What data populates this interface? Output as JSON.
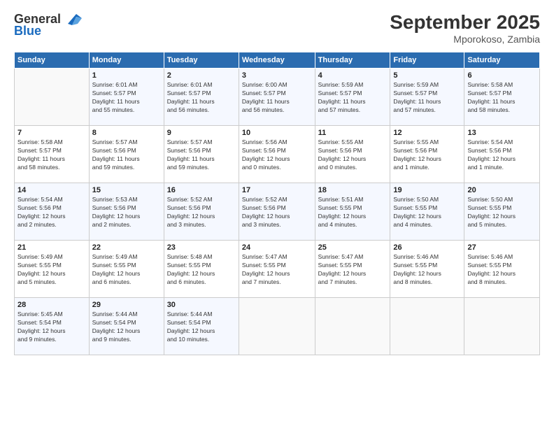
{
  "logo": {
    "text_general": "General",
    "text_blue": "Blue"
  },
  "header": {
    "month": "September 2025",
    "location": "Mporokoso, Zambia"
  },
  "weekdays": [
    "Sunday",
    "Monday",
    "Tuesday",
    "Wednesday",
    "Thursday",
    "Friday",
    "Saturday"
  ],
  "weeks": [
    [
      {
        "day": "",
        "info": ""
      },
      {
        "day": "1",
        "info": "Sunrise: 6:01 AM\nSunset: 5:57 PM\nDaylight: 11 hours\nand 55 minutes."
      },
      {
        "day": "2",
        "info": "Sunrise: 6:01 AM\nSunset: 5:57 PM\nDaylight: 11 hours\nand 56 minutes."
      },
      {
        "day": "3",
        "info": "Sunrise: 6:00 AM\nSunset: 5:57 PM\nDaylight: 11 hours\nand 56 minutes."
      },
      {
        "day": "4",
        "info": "Sunrise: 5:59 AM\nSunset: 5:57 PM\nDaylight: 11 hours\nand 57 minutes."
      },
      {
        "day": "5",
        "info": "Sunrise: 5:59 AM\nSunset: 5:57 PM\nDaylight: 11 hours\nand 57 minutes."
      },
      {
        "day": "6",
        "info": "Sunrise: 5:58 AM\nSunset: 5:57 PM\nDaylight: 11 hours\nand 58 minutes."
      }
    ],
    [
      {
        "day": "7",
        "info": "Sunrise: 5:58 AM\nSunset: 5:57 PM\nDaylight: 11 hours\nand 58 minutes."
      },
      {
        "day": "8",
        "info": "Sunrise: 5:57 AM\nSunset: 5:56 PM\nDaylight: 11 hours\nand 59 minutes."
      },
      {
        "day": "9",
        "info": "Sunrise: 5:57 AM\nSunset: 5:56 PM\nDaylight: 11 hours\nand 59 minutes."
      },
      {
        "day": "10",
        "info": "Sunrise: 5:56 AM\nSunset: 5:56 PM\nDaylight: 12 hours\nand 0 minutes."
      },
      {
        "day": "11",
        "info": "Sunrise: 5:55 AM\nSunset: 5:56 PM\nDaylight: 12 hours\nand 0 minutes."
      },
      {
        "day": "12",
        "info": "Sunrise: 5:55 AM\nSunset: 5:56 PM\nDaylight: 12 hours\nand 1 minute."
      },
      {
        "day": "13",
        "info": "Sunrise: 5:54 AM\nSunset: 5:56 PM\nDaylight: 12 hours\nand 1 minute."
      }
    ],
    [
      {
        "day": "14",
        "info": "Sunrise: 5:54 AM\nSunset: 5:56 PM\nDaylight: 12 hours\nand 2 minutes."
      },
      {
        "day": "15",
        "info": "Sunrise: 5:53 AM\nSunset: 5:56 PM\nDaylight: 12 hours\nand 2 minutes."
      },
      {
        "day": "16",
        "info": "Sunrise: 5:52 AM\nSunset: 5:56 PM\nDaylight: 12 hours\nand 3 minutes."
      },
      {
        "day": "17",
        "info": "Sunrise: 5:52 AM\nSunset: 5:56 PM\nDaylight: 12 hours\nand 3 minutes."
      },
      {
        "day": "18",
        "info": "Sunrise: 5:51 AM\nSunset: 5:55 PM\nDaylight: 12 hours\nand 4 minutes."
      },
      {
        "day": "19",
        "info": "Sunrise: 5:50 AM\nSunset: 5:55 PM\nDaylight: 12 hours\nand 4 minutes."
      },
      {
        "day": "20",
        "info": "Sunrise: 5:50 AM\nSunset: 5:55 PM\nDaylight: 12 hours\nand 5 minutes."
      }
    ],
    [
      {
        "day": "21",
        "info": "Sunrise: 5:49 AM\nSunset: 5:55 PM\nDaylight: 12 hours\nand 5 minutes."
      },
      {
        "day": "22",
        "info": "Sunrise: 5:49 AM\nSunset: 5:55 PM\nDaylight: 12 hours\nand 6 minutes."
      },
      {
        "day": "23",
        "info": "Sunrise: 5:48 AM\nSunset: 5:55 PM\nDaylight: 12 hours\nand 6 minutes."
      },
      {
        "day": "24",
        "info": "Sunrise: 5:47 AM\nSunset: 5:55 PM\nDaylight: 12 hours\nand 7 minutes."
      },
      {
        "day": "25",
        "info": "Sunrise: 5:47 AM\nSunset: 5:55 PM\nDaylight: 12 hours\nand 7 minutes."
      },
      {
        "day": "26",
        "info": "Sunrise: 5:46 AM\nSunset: 5:55 PM\nDaylight: 12 hours\nand 8 minutes."
      },
      {
        "day": "27",
        "info": "Sunrise: 5:46 AM\nSunset: 5:55 PM\nDaylight: 12 hours\nand 8 minutes."
      }
    ],
    [
      {
        "day": "28",
        "info": "Sunrise: 5:45 AM\nSunset: 5:54 PM\nDaylight: 12 hours\nand 9 minutes."
      },
      {
        "day": "29",
        "info": "Sunrise: 5:44 AM\nSunset: 5:54 PM\nDaylight: 12 hours\nand 9 minutes."
      },
      {
        "day": "30",
        "info": "Sunrise: 5:44 AM\nSunset: 5:54 PM\nDaylight: 12 hours\nand 10 minutes."
      },
      {
        "day": "",
        "info": ""
      },
      {
        "day": "",
        "info": ""
      },
      {
        "day": "",
        "info": ""
      },
      {
        "day": "",
        "info": ""
      }
    ]
  ]
}
